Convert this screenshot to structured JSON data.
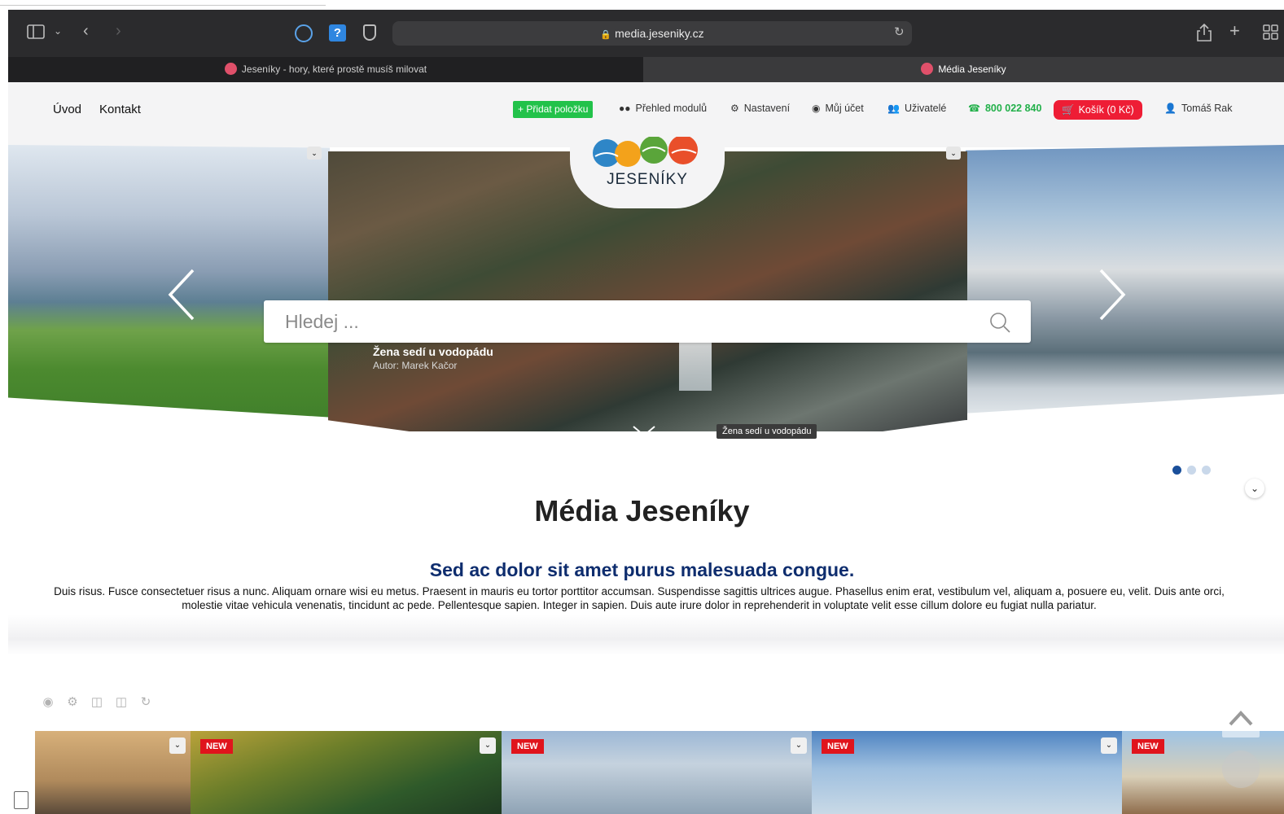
{
  "browser": {
    "url": "media.jeseniky.cz",
    "tabs": [
      {
        "label": "Jeseníky - hory, které prostě musíš milovat"
      },
      {
        "label": "Média Jeseníky"
      }
    ]
  },
  "nav": {
    "left": [
      "Úvod",
      "Kontakt"
    ],
    "add_item": "+ Přidat položku",
    "modules": "Přehled modulů",
    "settings": "Nastavení",
    "account": "Můj účet",
    "users": "Uživatelé",
    "phone": "800 022 840",
    "cart": "Košík (0 Kč)",
    "user": "Tomáš Rak"
  },
  "logo": {
    "text": "JESENÍKY"
  },
  "search": {
    "placeholder": "Hledej ..."
  },
  "slide": {
    "title": "Žena sedí u vodopádu",
    "author": "Autor: Marek Kačor",
    "tooltip": "Žena sedí u vodopádu"
  },
  "page": {
    "title": "Média Jeseníky",
    "subtitle": "Sed ac dolor sit amet purus malesuada congue.",
    "body": "Duis risus. Fusce consectetuer risus a nunc. Aliquam ornare wisi eu metus. Praesent in mauris eu tortor porttitor accumsan. Suspendisse sagittis ultrices augue. Phasellus enim erat, vestibulum vel, aliquam a, posuere eu, velit. Duis ante orci, molestie vitae vehicula venenatis, tincidunt ac pede. Pellentesque sapien. Integer in sapien. Duis aute irure dolor in reprehenderit in voluptate velit esse cillum dolore eu fugiat nulla pariatur."
  },
  "cards": {
    "badge": "NEW"
  },
  "colors": {
    "accent_green": "#22c24a",
    "cart_red": "#ee1d35",
    "subtitle_blue": "#0e2d6e",
    "badge_red": "#e0141c"
  }
}
